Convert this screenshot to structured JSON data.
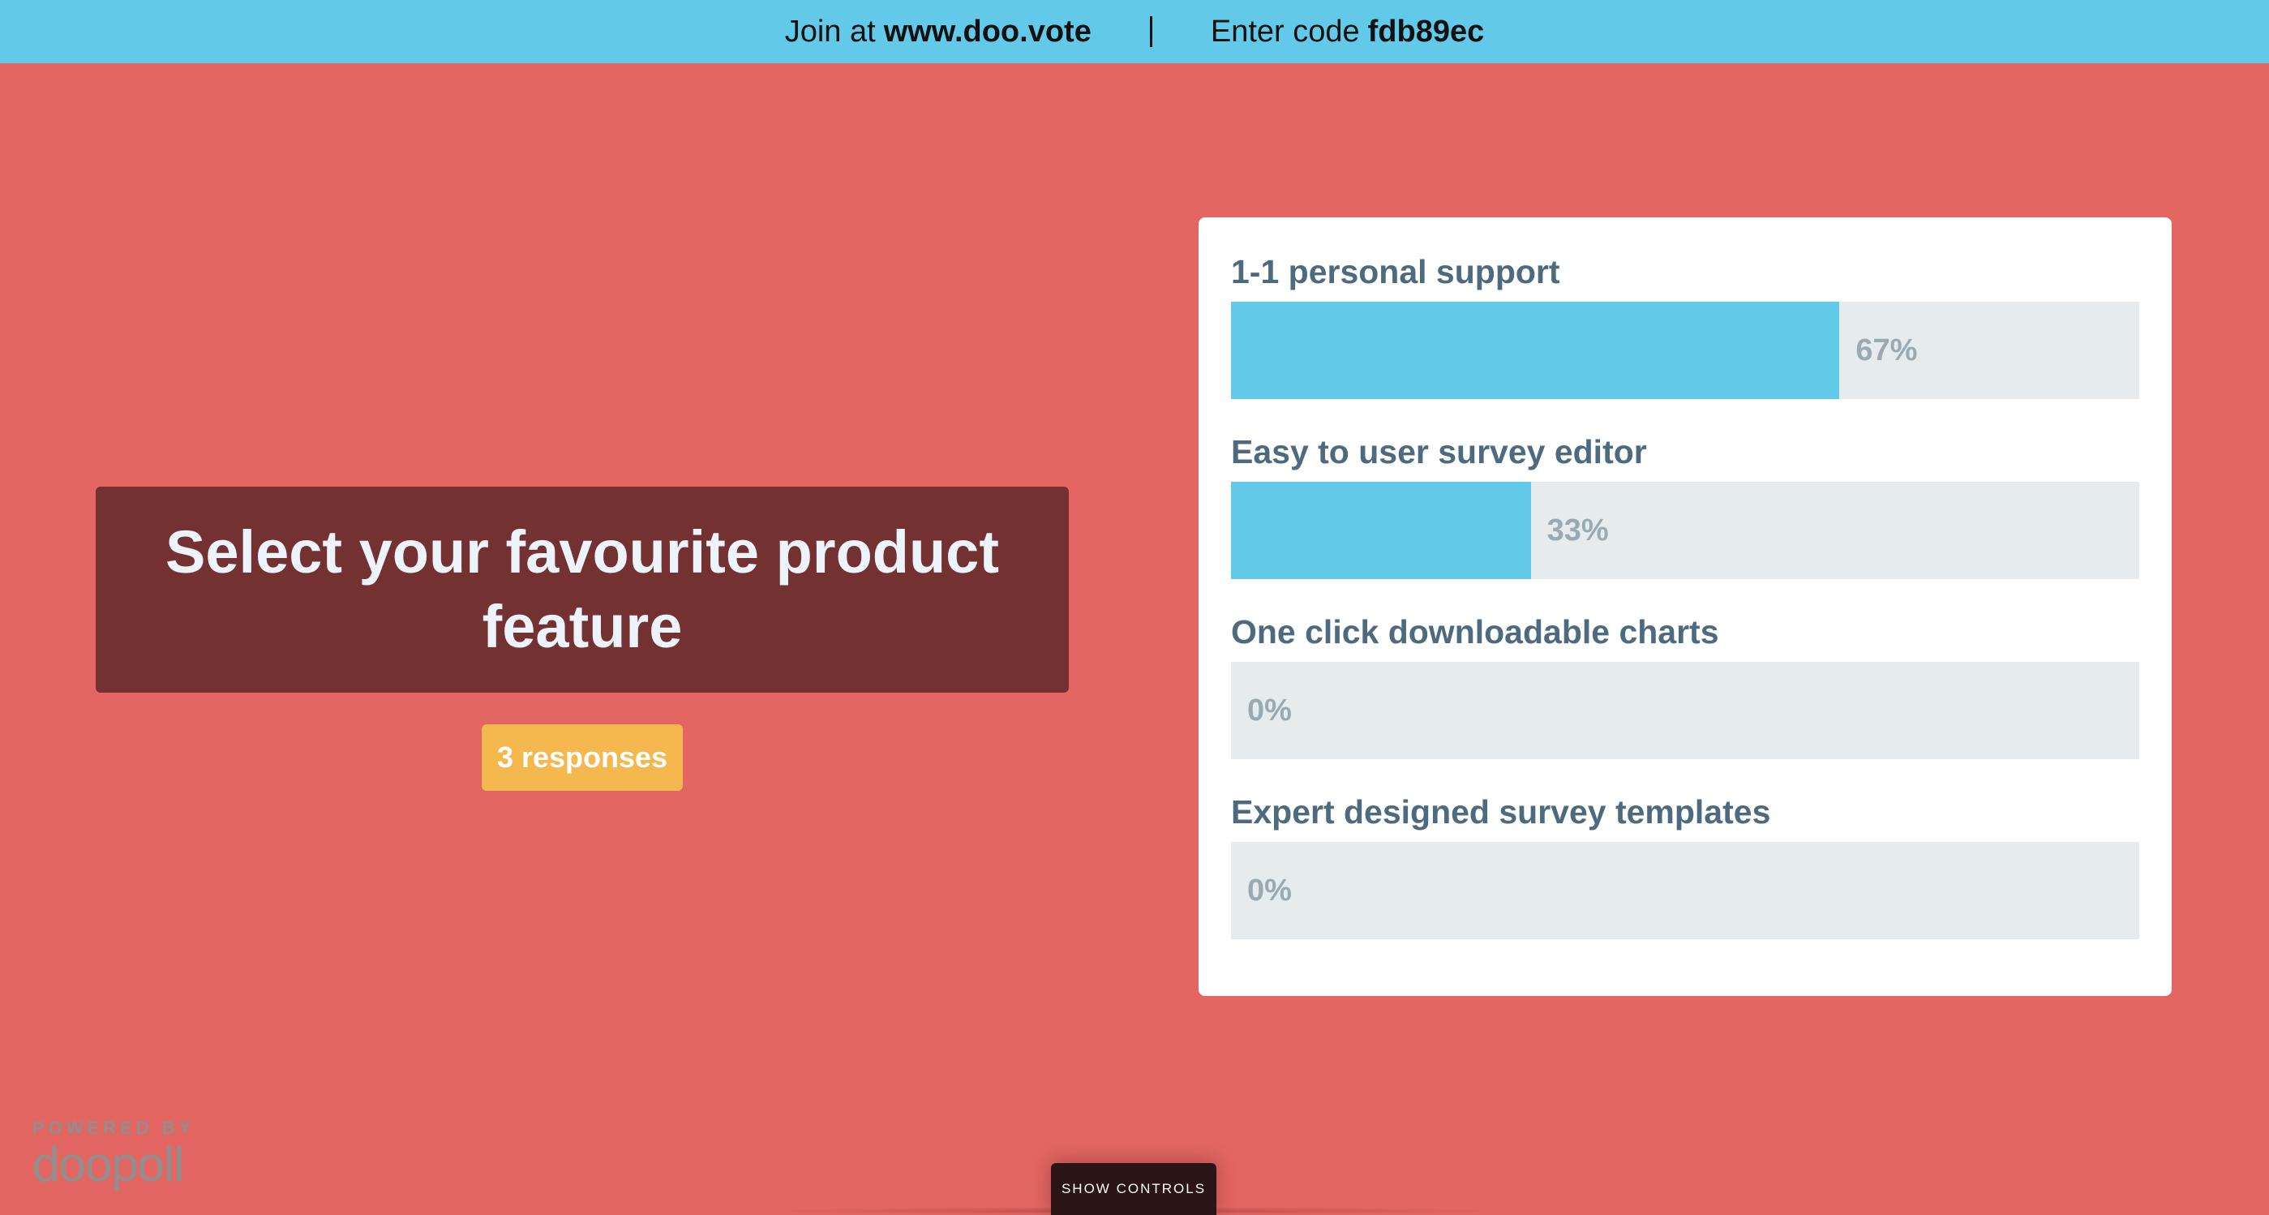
{
  "header": {
    "join_prefix": "Join at",
    "join_url": "www.doo.vote",
    "code_prefix": "Enter code",
    "code": "fdb89ec"
  },
  "question": {
    "text": "Select your favourite product feature",
    "responses_label": "3 responses"
  },
  "results": [
    {
      "label": "1-1 personal support",
      "percent": 67,
      "percent_label": "67%"
    },
    {
      "label": "Easy to user survey editor",
      "percent": 33,
      "percent_label": "33%"
    },
    {
      "label": "One click downloadable charts",
      "percent": 0,
      "percent_label": "0%"
    },
    {
      "label": "Expert designed survey templates",
      "percent": 0,
      "percent_label": "0%"
    }
  ],
  "footer": {
    "powered_by": "POWERED BY",
    "brand": "doopoll",
    "show_controls": "SHOW CONTROLS"
  },
  "colors": {
    "background": "#e36662",
    "accent": "#63c9e9",
    "question_box": "#733231",
    "responses_badge": "#f5b84e"
  }
}
